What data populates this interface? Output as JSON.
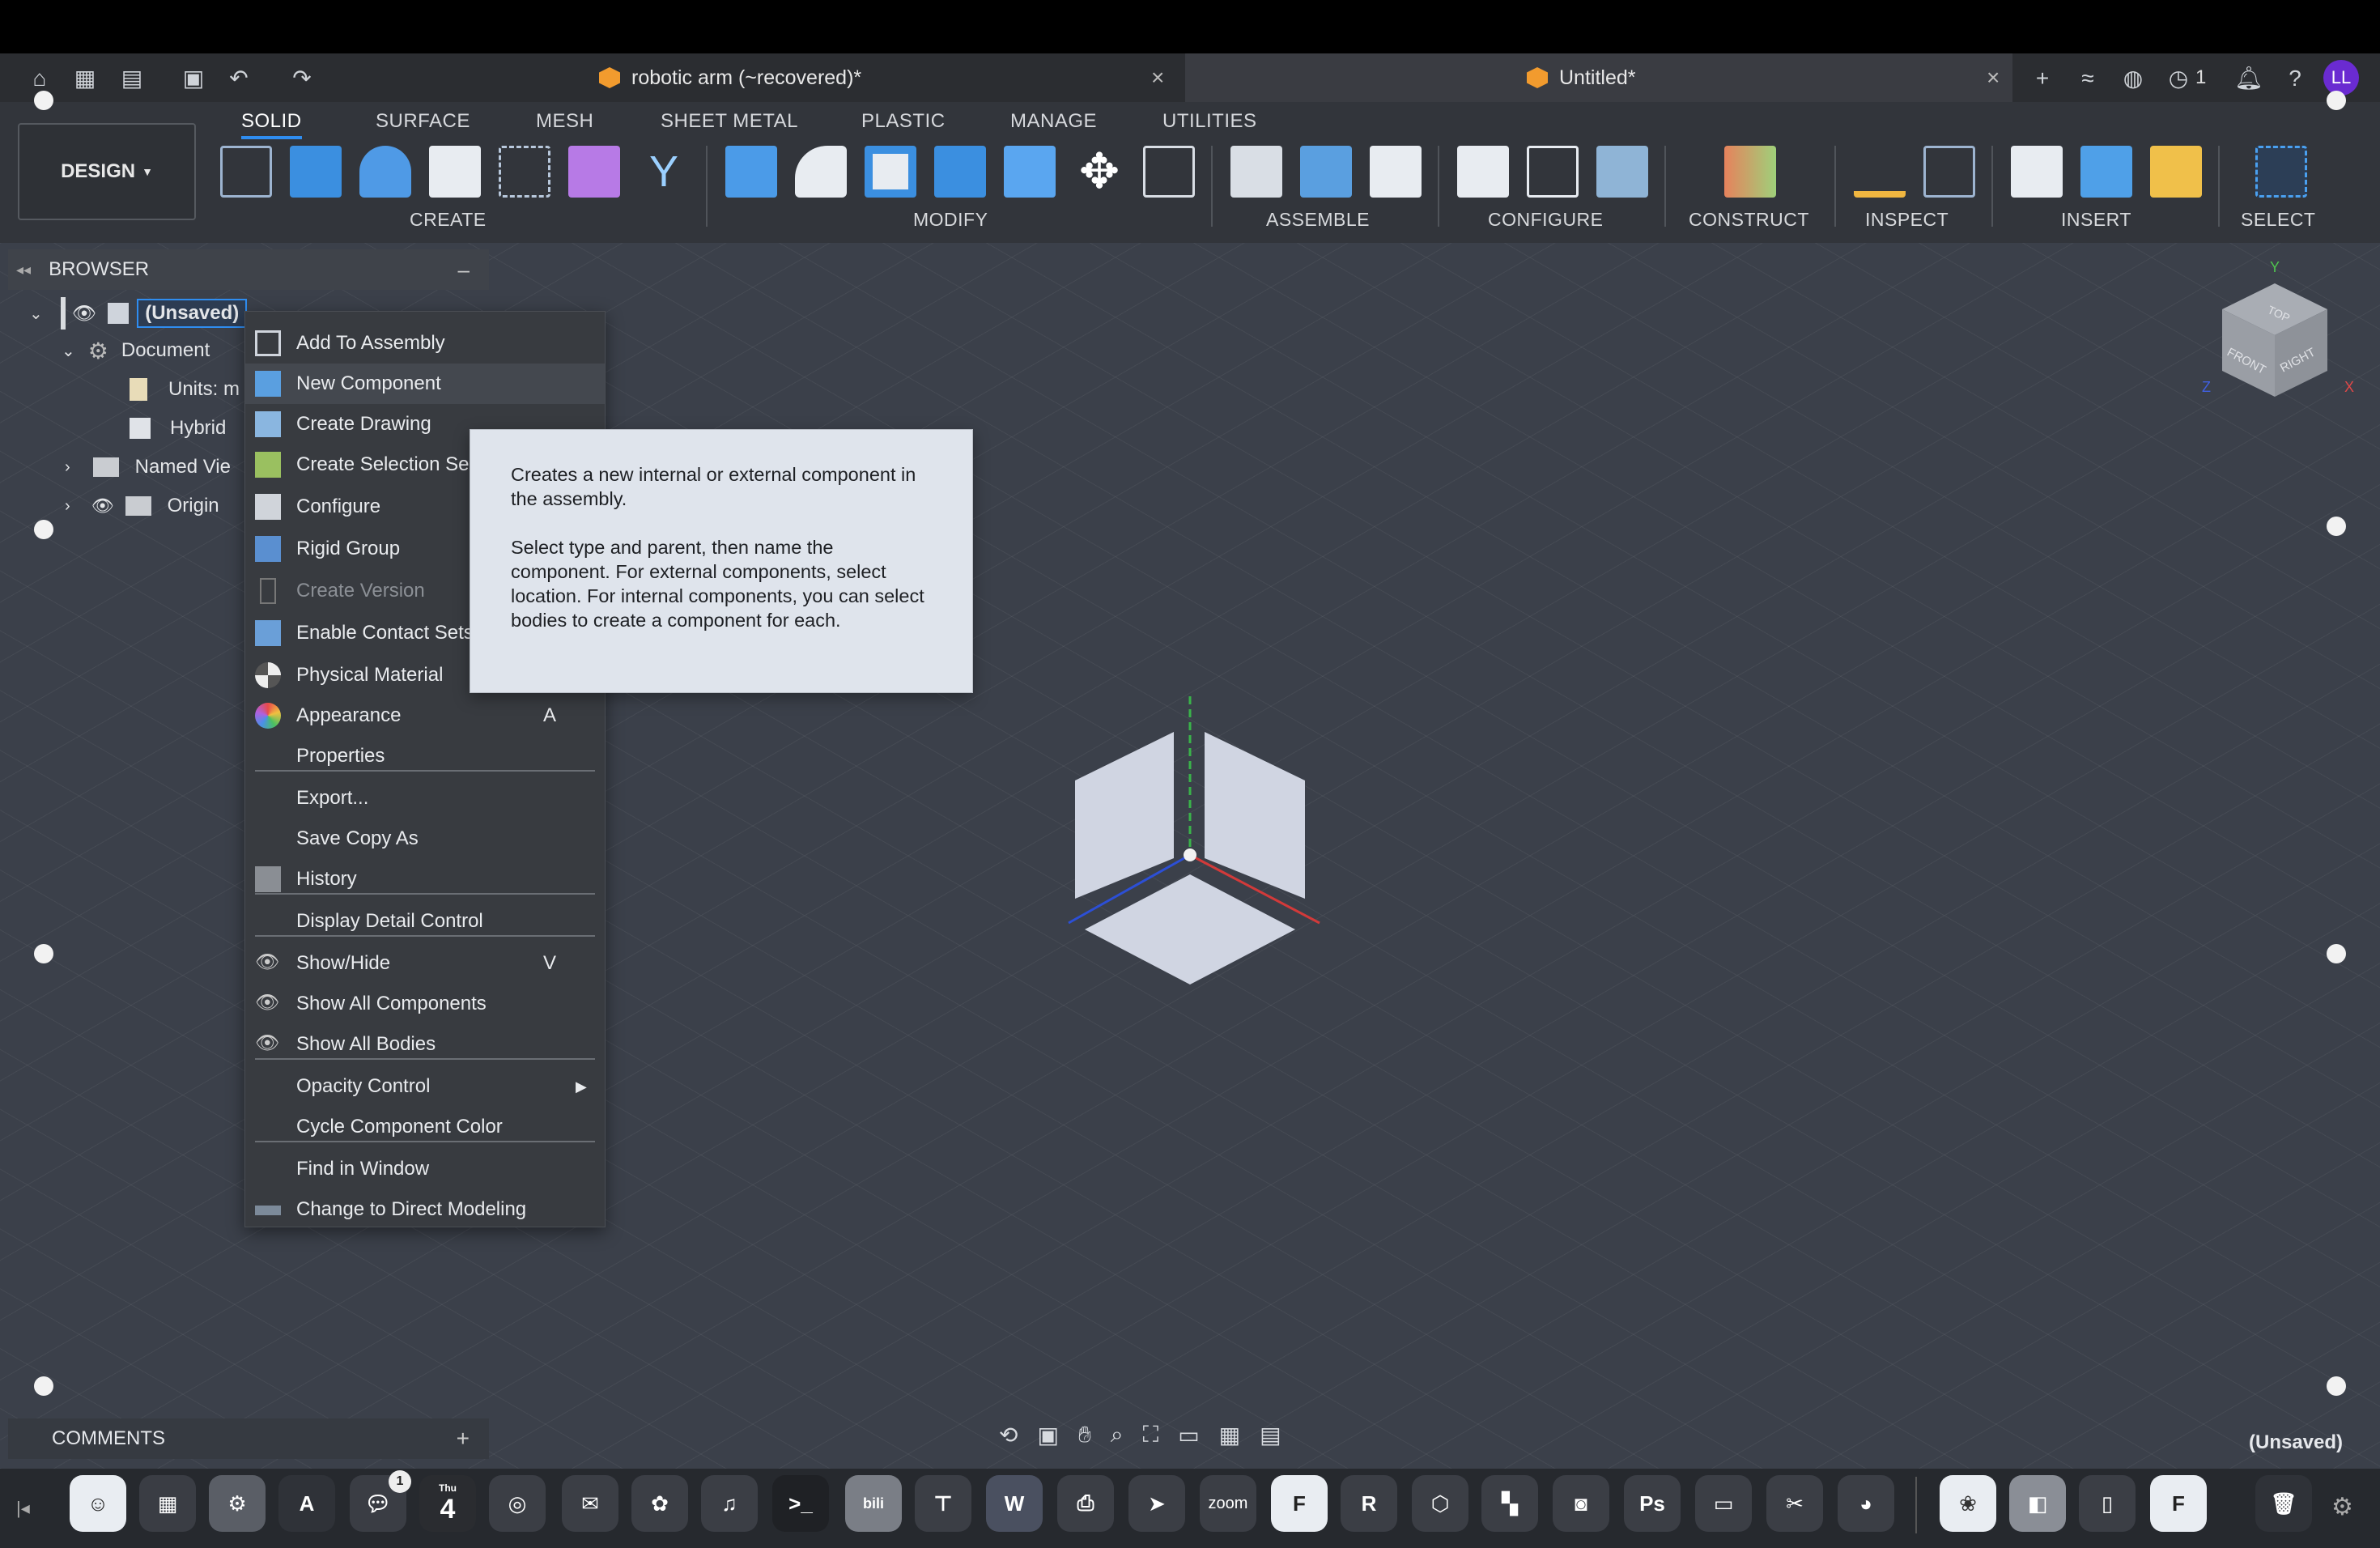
{
  "tabs": [
    {
      "label": "robotic arm (~recovered)*",
      "active": false
    },
    {
      "label": "Untitled*",
      "active": true
    }
  ],
  "topbar": {
    "job_count": "1",
    "avatar_initials": "LL"
  },
  "ribbon": {
    "workspace": "DESIGN",
    "tabs": [
      "SOLID",
      "SURFACE",
      "MESH",
      "SHEET METAL",
      "PLASTIC",
      "MANAGE",
      "UTILITIES"
    ],
    "groups": [
      "CREATE",
      "MODIFY",
      "ASSEMBLE",
      "CONFIGURE",
      "CONSTRUCT",
      "INSPECT",
      "INSERT",
      "SELECT"
    ]
  },
  "browser": {
    "title": "BROWSER",
    "rows": [
      {
        "label": "(Unsaved)"
      },
      {
        "label": "Document"
      },
      {
        "label": "Units: m"
      },
      {
        "label": "Hybrid"
      },
      {
        "label": "Named Vie"
      },
      {
        "label": "Origin"
      }
    ]
  },
  "context_menu": {
    "items": [
      {
        "label": "Add To Assembly"
      },
      {
        "label": "New Component"
      },
      {
        "label": "Create Drawing"
      },
      {
        "label": "Create Selection Se"
      },
      {
        "label": "Configure"
      },
      {
        "label": "Rigid Group"
      },
      {
        "label": "Create Version"
      },
      {
        "label": "Enable Contact Sets"
      },
      {
        "label": "Physical Material"
      },
      {
        "label": "Appearance",
        "shortcut": "A"
      },
      {
        "label": "Properties"
      },
      {
        "label": "Export..."
      },
      {
        "label": "Save Copy As"
      },
      {
        "label": "History"
      },
      {
        "label": "Display Detail Control"
      },
      {
        "label": "Show/Hide",
        "shortcut": "V"
      },
      {
        "label": "Show All Components"
      },
      {
        "label": "Show All Bodies"
      },
      {
        "label": "Opacity Control"
      },
      {
        "label": "Cycle Component Color"
      },
      {
        "label": "Find in Window"
      },
      {
        "label": "Change to Direct Modeling"
      }
    ]
  },
  "tooltip": {
    "para1": "Creates a new internal or external component in the assembly.",
    "para2": "Select type and parent, then name the component. For external components, select location. For internal components, you can select bodies to create a component for each."
  },
  "viewcube": {
    "top": "TOP",
    "front": "FRONT",
    "right": "RIGHT",
    "x": "X",
    "y": "Y",
    "z": "Z"
  },
  "comments": {
    "title": "COMMENTS"
  },
  "status": {
    "doc_name": "(Unsaved)"
  },
  "dock": {
    "calendar_day": "4",
    "calendar_month": "Thu",
    "messages_badge": "1",
    "zoom_label": "zoom"
  },
  "colors": {
    "accent": "#2f8df0",
    "tab_cube": "#f29b2e",
    "canvas": "#3b404a",
    "avatar": "#6a2bd1"
  }
}
